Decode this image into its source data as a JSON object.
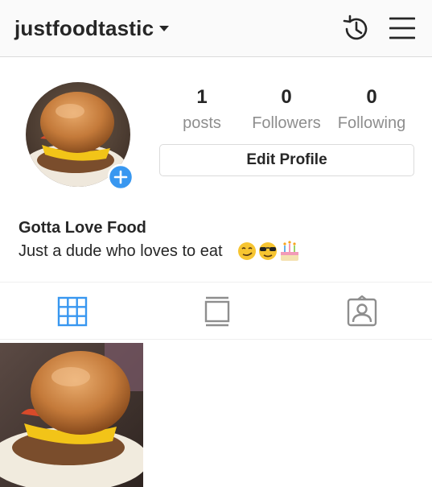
{
  "header": {
    "username": "justfoodtastic",
    "icons": [
      "chevron-down-icon",
      "history-icon",
      "hamburger-menu-icon"
    ]
  },
  "profile": {
    "stats": [
      {
        "value": "1",
        "label": "posts"
      },
      {
        "value": "0",
        "label": "Followers"
      },
      {
        "value": "0",
        "label": "Following"
      }
    ],
    "edit_button": "Edit Profile",
    "name": "Gotta Love Food",
    "bio": "Just a dude who loves to eat"
  },
  "tabs": [
    "grid-icon",
    "feed-list-icon",
    "tagged-icon"
  ],
  "colors": {
    "accent": "#3897f0",
    "text": "#262626",
    "muted": "#8e8e8e",
    "border": "#dbdbdb"
  }
}
